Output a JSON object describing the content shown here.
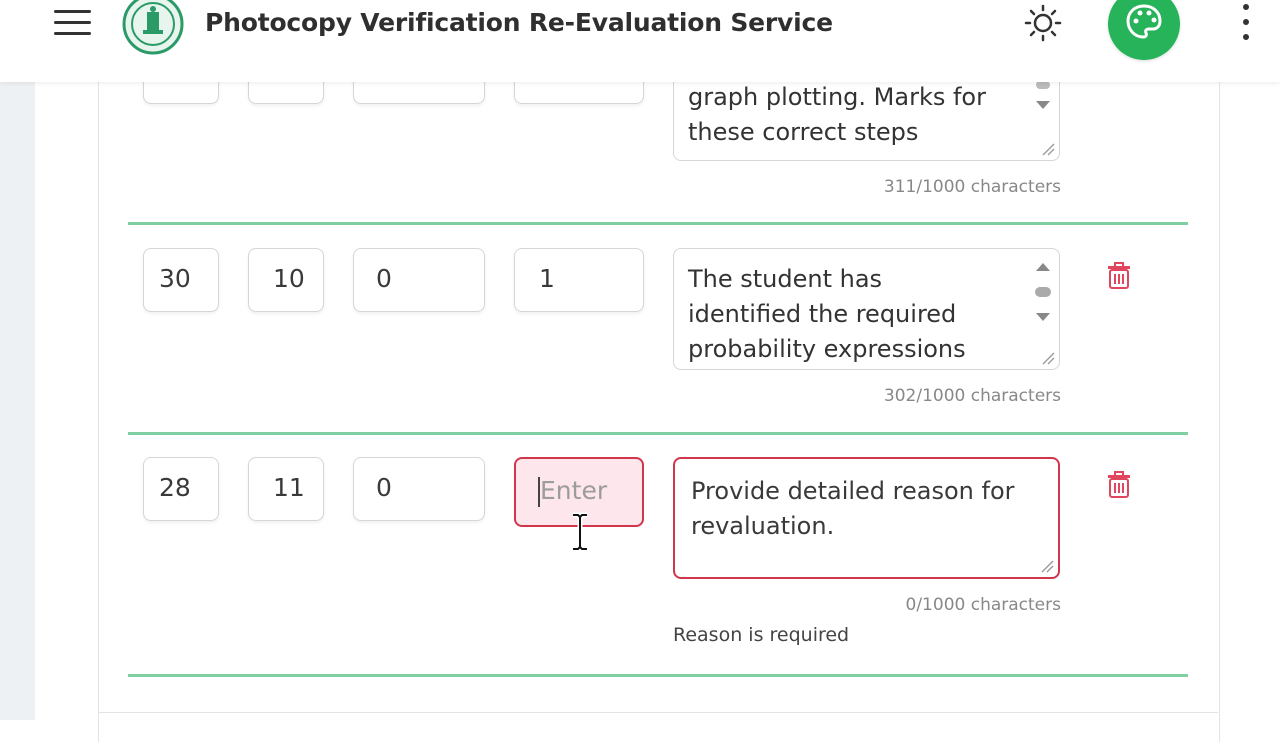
{
  "header": {
    "title": "Photocopy Verification Re-Evaluation Service",
    "icons": [
      "menu-icon",
      "board-logo",
      "sun-icon",
      "palette-icon",
      "more-vert-icon"
    ],
    "accent": "#26b35a"
  },
  "rows": [
    {
      "values": [
        "",
        "",
        "",
        ""
      ],
      "reason": "graph plotting. Marks for these correct steps",
      "char_count": "311/1000 characters"
    },
    {
      "values": [
        "30",
        "10",
        "0",
        "1"
      ],
      "reason": "The student has identified the required probability expressions",
      "char_count": "302/1000 characters"
    },
    {
      "values": [
        "28",
        "11",
        "0",
        ""
      ],
      "marks_placeholder": "Enter",
      "reason_placeholder": "Provide detailed reason for revaluation.",
      "char_count": "0/1000 characters",
      "error": "Reason is required"
    }
  ],
  "colors": {
    "divider": "#7fcfa2",
    "error": "#d1374b",
    "error_bg": "#fde7ec",
    "delete": "#e0475e"
  }
}
